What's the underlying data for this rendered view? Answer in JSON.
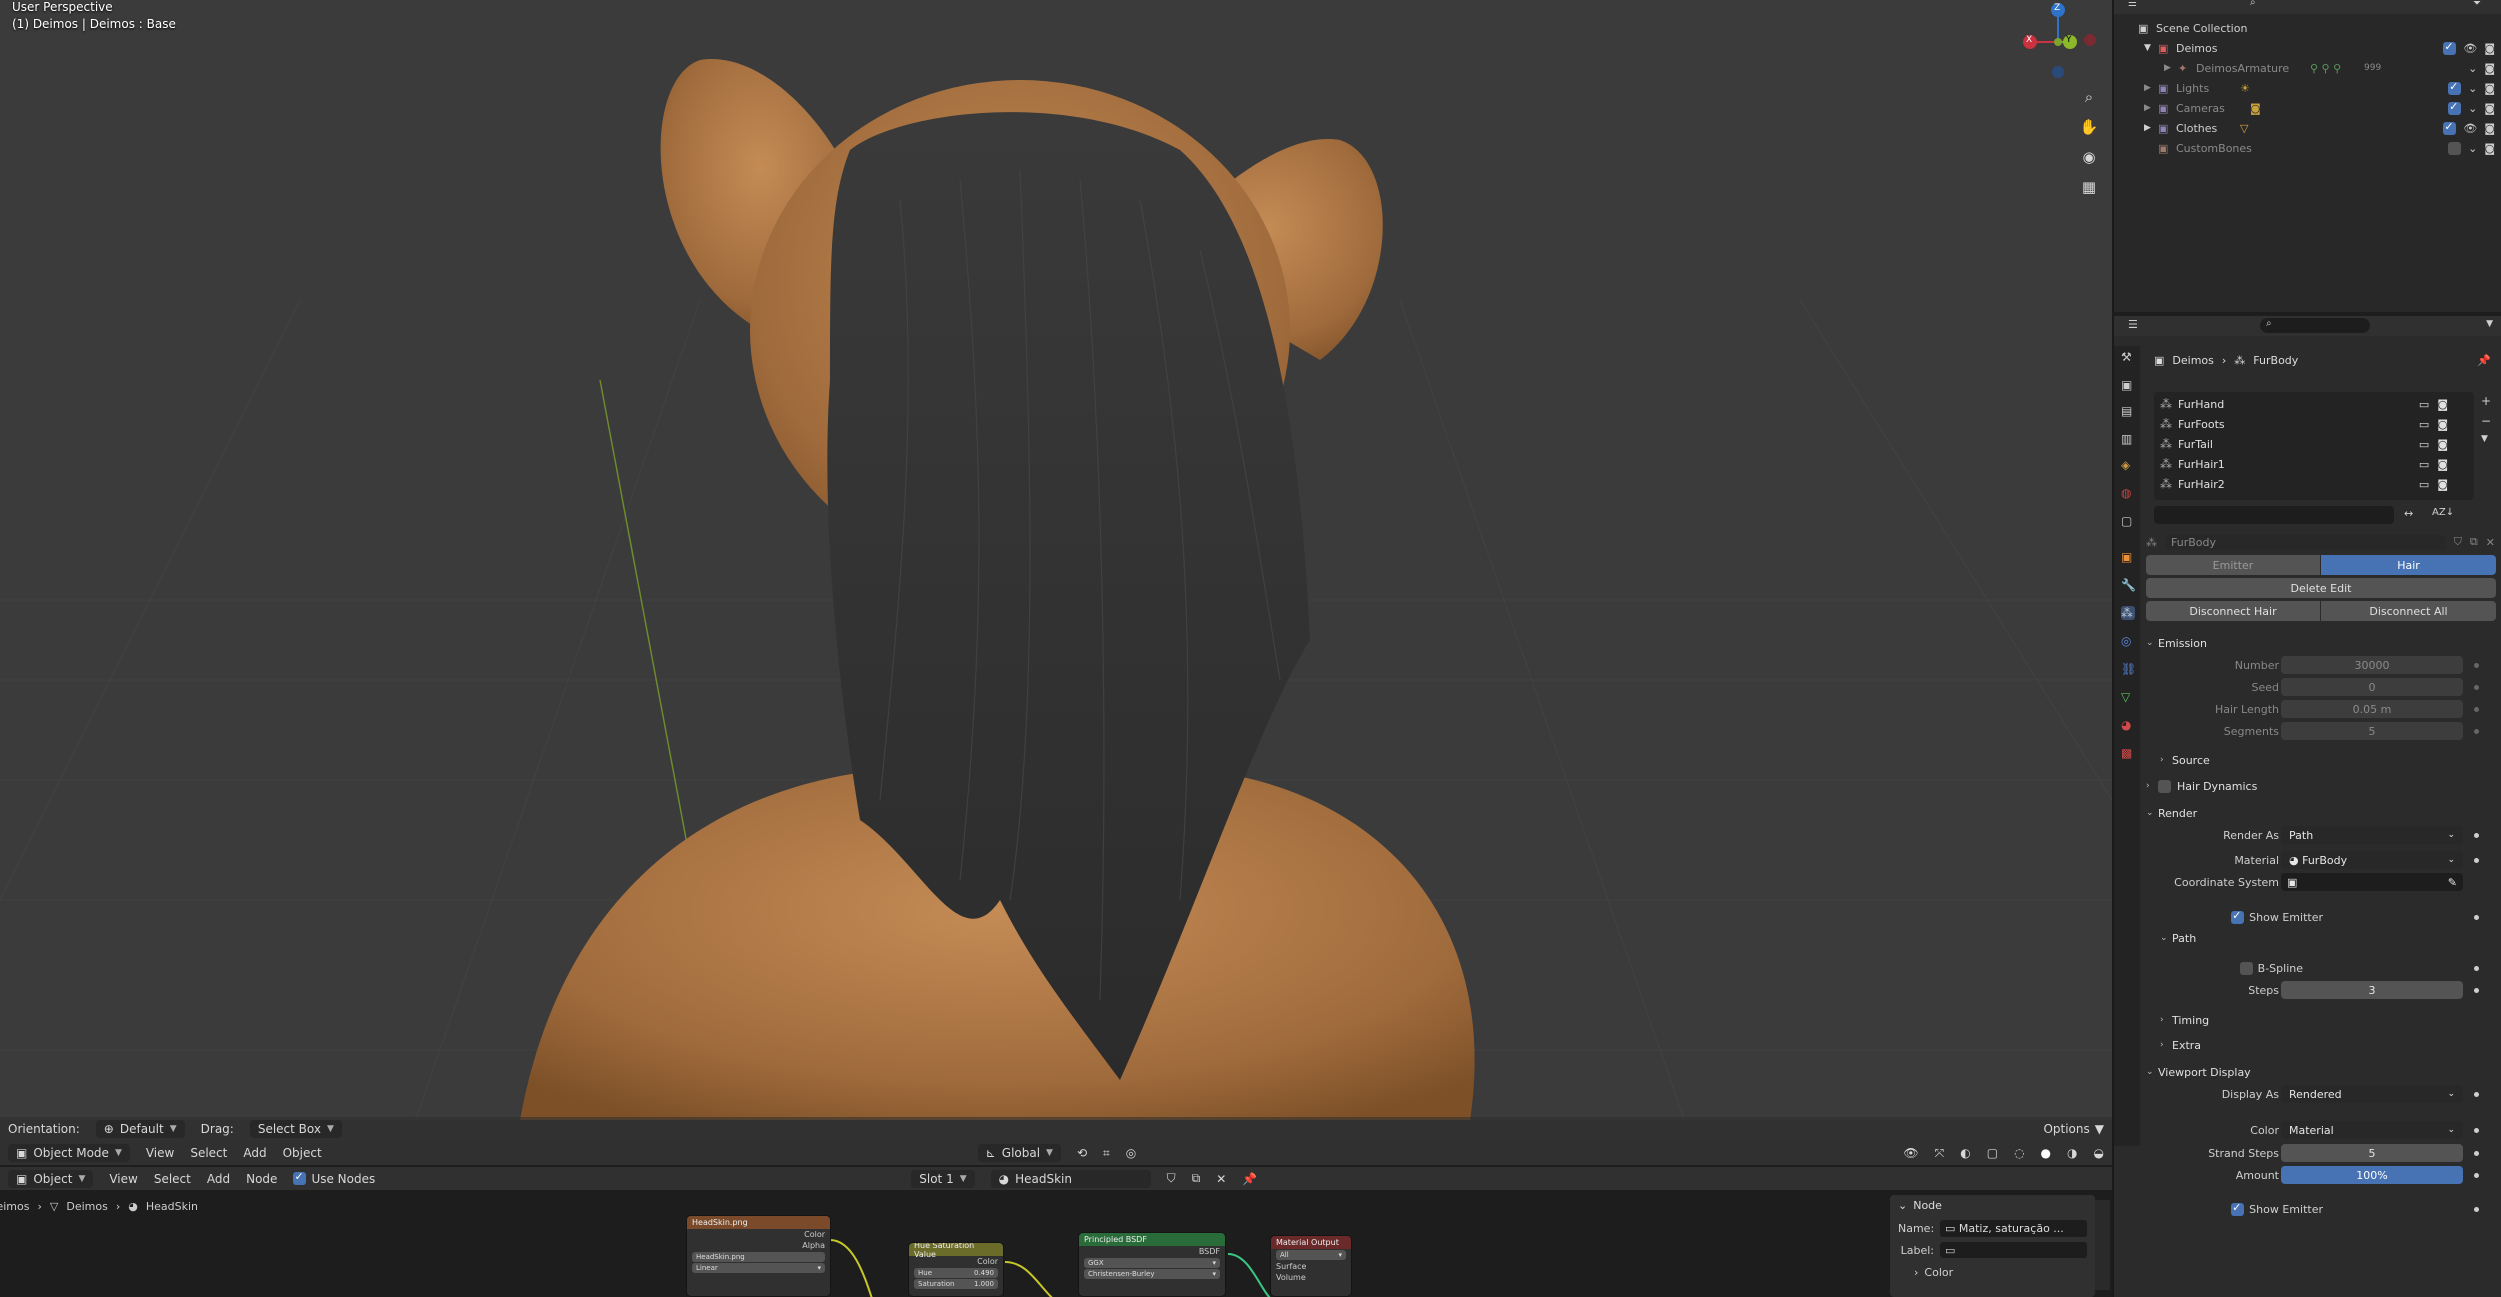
{
  "viewport": {
    "title": "User Perspective",
    "subtitle": "(1) Deimos | Deimos : Base",
    "gizmo": {
      "x": "X",
      "y": "Y",
      "z": "Z"
    },
    "tool_header": {
      "orientation_label": "Orientation:",
      "orientation_value": "Default",
      "drag_label": "Drag:",
      "drag_value": "Select Box",
      "options": "Options"
    },
    "header": {
      "mode": "Object Mode",
      "menus": [
        "View",
        "Select",
        "Add",
        "Object"
      ],
      "transform": "Global"
    }
  },
  "node_editor": {
    "header": {
      "type": "Object",
      "menus": [
        "View",
        "Select",
        "Add",
        "Node"
      ],
      "use_nodes_label": "Use Nodes",
      "slot": "Slot 1",
      "material": "HeadSkin"
    },
    "breadcrumb": [
      "Deimos",
      "Deimos",
      "HeadSkin"
    ],
    "nodes": {
      "image": {
        "title": "HeadSkin.png",
        "out1": "Color",
        "out2": "Alpha",
        "file": "HeadSkin.png",
        "interp": "Linear"
      },
      "hsv": {
        "title": "Hue Saturation Value",
        "out": "Color",
        "f1": "Hue",
        "v1": "0.490",
        "f2": "Saturation",
        "v2": "1.000"
      },
      "bsdf": {
        "title": "Principled BSDF",
        "out": "BSDF",
        "d1": "GGX",
        "d2": "Christensen-Burley"
      },
      "output": {
        "title": "Material Output",
        "d1": "All",
        "in1": "Surface",
        "in2": "Volume"
      }
    },
    "side_panel": {
      "section": "Node",
      "name_label": "Name:",
      "name_value": "Matiz, saturação ...",
      "label_label": "Label:",
      "color_section": "Color"
    }
  },
  "outliner": {
    "root": "Scene Collection",
    "items": [
      {
        "label": "Deimos",
        "color": "#e05c5c"
      },
      {
        "label": "DeimosArmature",
        "color": "#a07a6c"
      },
      {
        "label": "Lights",
        "color": "#8f83b5"
      },
      {
        "label": "Cameras",
        "color": "#8f83b5"
      },
      {
        "label": "Clothes",
        "color": "#8f83b5"
      },
      {
        "label": "CustomBones",
        "color": "#a07a6c"
      }
    ],
    "armature_count": "999"
  },
  "properties": {
    "breadcrumb": [
      "Deimos",
      "FurBody"
    ],
    "systems": [
      "FurHand",
      "FurFoots",
      "FurTail",
      "FurHair1",
      "FurHair2"
    ],
    "settings_name": "FurBody",
    "type_tabs": [
      "Emitter",
      "Hair"
    ],
    "buttons": {
      "delete_edit": "Delete Edit",
      "disconnect_hair": "Disconnect Hair",
      "disconnect_all": "Disconnect All"
    },
    "emission": {
      "title": "Emission",
      "number_label": "Number",
      "number": "30000",
      "seed_label": "Seed",
      "seed": "0",
      "hair_length_label": "Hair Length",
      "hair_length": "0.05 m",
      "segments_label": "Segments",
      "segments": "5"
    },
    "source": "Source",
    "hair_dynamics": "Hair Dynamics",
    "render": {
      "title": "Render",
      "render_as_label": "Render As",
      "render_as": "Path",
      "material_label": "Material",
      "material": "FurBody",
      "coord_label": "Coordinate System",
      "show_emitter": "Show Emitter",
      "path_title": "Path",
      "bspline": "B-Spline",
      "steps_label": "Steps",
      "steps": "3",
      "timing": "Timing",
      "extra": "Extra"
    },
    "viewport_display": {
      "title": "Viewport Display",
      "display_as_label": "Display As",
      "display_as": "Rendered",
      "color_label": "Color",
      "color": "Material",
      "strand_steps_label": "Strand Steps",
      "strand_steps": "5",
      "amount_label": "Amount",
      "amount": "100%",
      "show_emitter": "Show Emitter"
    }
  }
}
